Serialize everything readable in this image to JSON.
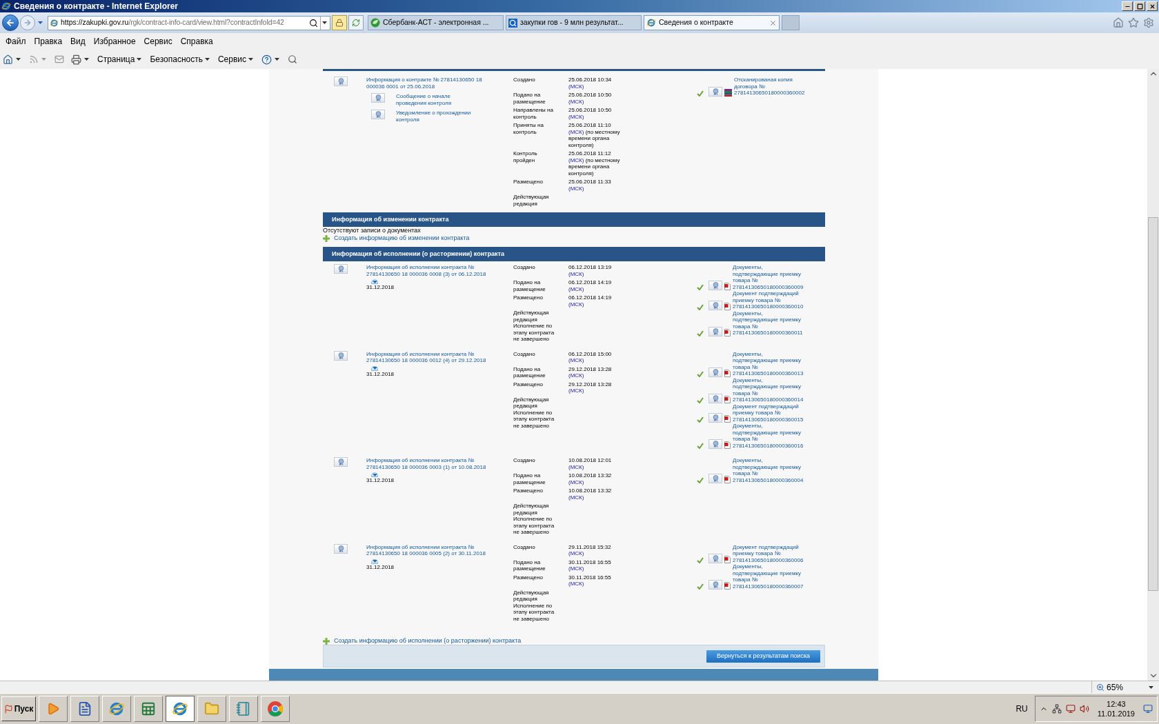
{
  "window": {
    "title": "Сведения о контракте - Internet Explorer"
  },
  "address_bar": {
    "url_host": "https://zakupki.gov.ru",
    "url_path": "/rgk/contract-info-card/view.html?contractInfoId=42"
  },
  "tabs": [
    {
      "label": "Сбербанк-АСТ - электронная ...",
      "selected": false,
      "kind": "site"
    },
    {
      "label": "закупки гов - 9 млн результат...",
      "selected": false,
      "kind": "search"
    },
    {
      "label": "Сведения о контракте",
      "selected": true,
      "kind": "ie"
    }
  ],
  "menu": [
    "Файл",
    "Правка",
    "Вид",
    "Избранное",
    "Сервис",
    "Справка"
  ],
  "command_bar": [
    "Страница",
    "Безопасность",
    "Сервис"
  ],
  "contract": {
    "title": "Информация о контракте № 27814130650 18 000036 0001 от 25.06.2018",
    "sub_links": [
      "Сообщение о начале проведения контроля",
      "Уведомление о прохождении контроля"
    ],
    "events": [
      {
        "label": "Создано",
        "date": "25.06.2018 10:34",
        "tz": "(МСК)"
      },
      {
        "label": "Подано на размещение",
        "date": "25.06.2018 10:50",
        "tz": "(МСК)"
      },
      {
        "label": "Направлены на контроль",
        "date": "25.06.2018 10:50",
        "tz": "(МСК)"
      },
      {
        "label": "Приняты на контроль",
        "date": "25.06.2018 11:10",
        "tz": "(МСК)",
        "note": "(по местному времени органа контроля)"
      },
      {
        "label": "Контроль пройден",
        "date": "25.06.2018 11:12",
        "tz": "(МСК)",
        "note": "(по местному времени органа контроля)"
      },
      {
        "label": "Размещено",
        "date": "25.06.2018 11:33",
        "tz": "(МСК)"
      },
      {
        "label": "Действующая редакция"
      }
    ],
    "documents": [
      {
        "title": "Отсканированая копия договора № 27814130650180000360002",
        "kind": "archive",
        "verified": true
      }
    ]
  },
  "change_section": {
    "title": "Информация об изменении контракта",
    "empty_text": "Отсутствуют записи о документах",
    "create_link": "Создать информацию об изменении контракта"
  },
  "execution_section": {
    "title": "Информация об исполнении (о расторжении) контракта",
    "entries": [
      {
        "title": "Информация об исполнении контракта № 27814130650 18 000036 0008 (3) от 06.12.2018",
        "date": "31.12.2018",
        "events": [
          {
            "label": "Создано",
            "date": "06.12.2018 13:19",
            "tz": "(МСК)"
          },
          {
            "label": "Подано на размещение",
            "date": "06.12.2018 14:19",
            "tz": "(МСК)"
          },
          {
            "label": "Размещено",
            "date": "06.12.2018 14:19",
            "tz": "(МСК)"
          },
          {
            "label": "Действующая редакция"
          },
          {
            "label": "Исполнение по этапу контракта не завершено"
          }
        ],
        "documents": [
          {
            "title": "Документы, подтверждающие приемку товара № 27814130650180000360009",
            "kind": "pdf",
            "verified": true
          },
          {
            "title": "Документ подтверждаций приемку товара № 27814130650180000360010",
            "kind": "pdf",
            "verified": true
          },
          {
            "title": "Документы, подтверждающие приемку товара № 27814130650180000360011",
            "kind": "pdf",
            "verified": true
          }
        ]
      },
      {
        "title": "Информация об исполнении контракта № 27814130650 18 000036 0012 (4) от 29.12.2018",
        "date": "31.12.2018",
        "events": [
          {
            "label": "Создано",
            "date": "06.12.2018 15:00",
            "tz": "(МСК)"
          },
          {
            "label": "Подано на размещение",
            "date": "29.12.2018 13:28",
            "tz": "(МСК)"
          },
          {
            "label": "Размещено",
            "date": "29.12.2018 13:28",
            "tz": "(МСК)"
          },
          {
            "label": "Действующая редакция"
          },
          {
            "label": "Исполнение по этапу контракта не завершено"
          }
        ],
        "documents": [
          {
            "title": "Документы, подтверждающие приемку товара № 27814130650180000360013",
            "kind": "pdf",
            "verified": true
          },
          {
            "title": "Документы, подтверждающие приемку товара № 27814130650180000360014",
            "kind": "pdf",
            "verified": true
          },
          {
            "title": "Документ подтверждаций приемку товара № 27814130650180000360015",
            "kind": "pdf",
            "verified": true
          },
          {
            "title": "Документы, подтверждающие приемку товара № 27814130650180000360016",
            "kind": "pdf",
            "verified": true
          }
        ]
      },
      {
        "title": "Информация об исполнении контракта № 27814130650 18 000036 0003 (1) от 10.08.2018",
        "date": "31.12.2018",
        "events": [
          {
            "label": "Создано",
            "date": "10.08.2018 12:01",
            "tz": "(МСК)"
          },
          {
            "label": "Подано на размещение",
            "date": "10.08.2018 13:32",
            "tz": "(МСК)"
          },
          {
            "label": "Размещено",
            "date": "10.08.2018 13:32",
            "tz": "(МСК)"
          },
          {
            "label": "Действующая редакция"
          },
          {
            "label": "Исполнение по этапу контракта не завершено"
          }
        ],
        "documents": [
          {
            "title": "Документы, подтверждающие приемку товара № 27814130650180000360004",
            "kind": "pdf",
            "verified": true
          }
        ]
      },
      {
        "title": "Информация об исполнении контракта № 27814130650 18 000036 0005 (2) от 30.11.2018",
        "date": "31.12.2018",
        "events": [
          {
            "label": "Создано",
            "date": "29.11.2018 15:32",
            "tz": "(МСК)"
          },
          {
            "label": "Подано на размещение",
            "date": "30.11.2018 16:55",
            "tz": "(МСК)"
          },
          {
            "label": "Размещено",
            "date": "30.11.2018 16:55",
            "tz": "(МСК)"
          },
          {
            "label": "Действующая редакция"
          },
          {
            "label": "Исполнение по этапу контракта не завершено"
          }
        ],
        "documents": [
          {
            "title": "Документ подтверждаций приемку товара № 27814130650180000360006",
            "kind": "pdf",
            "verified": true
          },
          {
            "title": "Документы, подтверждающие приемку товара № 27814130650180000360007",
            "kind": "pdf",
            "verified": true
          }
        ]
      }
    ],
    "create_link": "Создать информацию об исполнении (о расторжении) контракта",
    "back_button": "Вернуться к результатам поиска"
  },
  "status_bar": {
    "zoom": "65%"
  },
  "taskbar": {
    "start": "Пуск",
    "language": "RU",
    "time": "12:43",
    "date": "11.01.2019"
  }
}
